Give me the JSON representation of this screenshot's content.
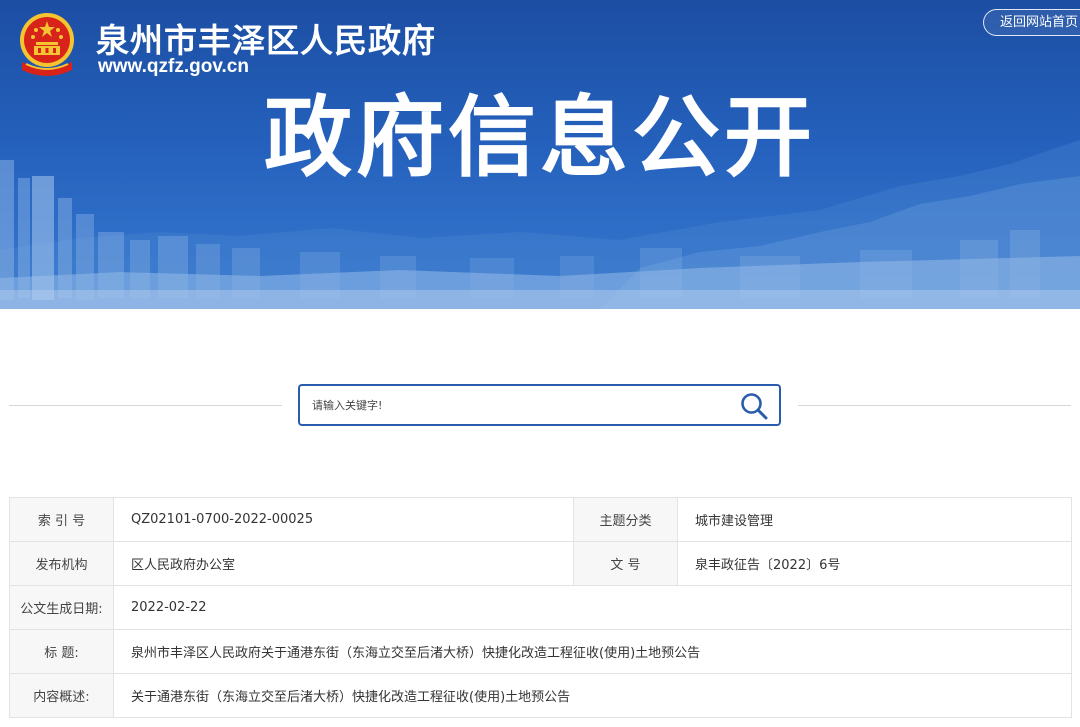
{
  "header": {
    "site_name": "泉州市丰泽区人民政府",
    "site_url": "www.qzfz.gov.cn",
    "back_home": "返回网站首页",
    "headline": "政府信息公开"
  },
  "search": {
    "placeholder": "请输入关键字!"
  },
  "info": {
    "index_label": "索 引 号",
    "index_value": "QZ02101-0700-2022-00025",
    "topic_label": "主题分类",
    "topic_value": "城市建设管理",
    "org_label": "发布机构",
    "org_value": "区人民政府办公室",
    "docno_label": "文  号",
    "docno_value": "泉丰政征告〔2022〕6号",
    "date_label": "公文生成日期:",
    "date_value": "2022-02-22",
    "title_label": "标  题:",
    "title_value": "泉州市丰泽区人民政府关于通港东街（东海立交至后渚大桥）快捷化改造工程征收(使用)土地预公告",
    "summary_label": "内容概述:",
    "summary_value": "关于通港东街（东海立交至后渚大桥）快捷化改造工程征收(使用)土地预公告"
  },
  "colors": {
    "banner_blue": "#2460bb",
    "search_border": "#2a5cad",
    "emblem_red": "#d8231a",
    "emblem_gold": "#f4c531"
  },
  "icons": {
    "emblem": "national-emblem-icon",
    "search": "search-icon"
  }
}
